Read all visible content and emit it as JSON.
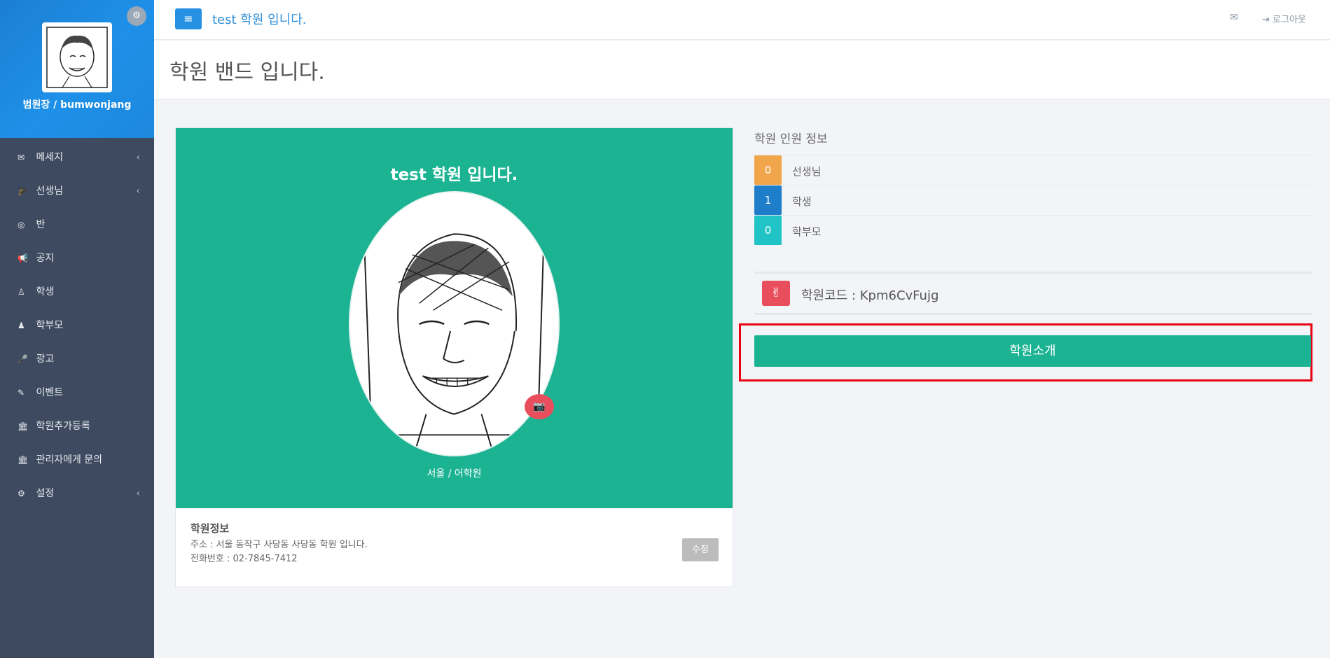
{
  "sidebar": {
    "user_name": "범원장 / bumwonjang",
    "settings_icon": "gear-icon",
    "items": [
      {
        "label": "메세지",
        "icon": "envelope-icon",
        "glyph": "✉",
        "has_arrow": true
      },
      {
        "label": "선생님",
        "icon": "graduation-cap-icon",
        "glyph": "🎓",
        "has_arrow": true
      },
      {
        "label": "반",
        "icon": "bullseye-icon",
        "glyph": "◎",
        "has_arrow": false
      },
      {
        "label": "공지",
        "icon": "bullhorn-icon",
        "glyph": "📢",
        "has_arrow": false
      },
      {
        "label": "학생",
        "icon": "child-icon",
        "glyph": "♙",
        "has_arrow": false
      },
      {
        "label": "학부모",
        "icon": "male-icon",
        "glyph": "♟",
        "has_arrow": false
      },
      {
        "label": "광고",
        "icon": "microphone-icon",
        "glyph": "🎤",
        "has_arrow": false
      },
      {
        "label": "이벤트",
        "icon": "magic-wand-icon",
        "glyph": "✎",
        "has_arrow": false
      },
      {
        "label": "학원추가등록",
        "icon": "institution-icon",
        "glyph": "🏛",
        "has_arrow": false
      },
      {
        "label": "관리자에게 문의",
        "icon": "institution-icon",
        "glyph": "🏛",
        "has_arrow": false
      },
      {
        "label": "설정",
        "icon": "gear-icon",
        "glyph": "⚙",
        "has_arrow": true
      }
    ],
    "arrow_glyph": "‹"
  },
  "topbar": {
    "menu_glyph": "≡",
    "title": "test 학원 입니다.",
    "envelope_glyph": "✉",
    "logout_label": "⇥ 로그아웃"
  },
  "page": {
    "title": "학원 밴드 입니다."
  },
  "profile_card": {
    "name": "test 학원 입니다.",
    "camera_glyph": "📷",
    "location": "서울 / 어학원",
    "info_title": "학원정보",
    "address": "주소 : 서울 동작구 사당동 사당동 학원 입니다.",
    "phone": "전화번호 : 02-7845-7412",
    "edit_label": "수정"
  },
  "stats": {
    "title": "학원 인원 정보",
    "rows": [
      {
        "count": "0",
        "label": "선생님",
        "color": "#f0a54a"
      },
      {
        "count": "1",
        "label": "학생",
        "color": "#1f7ec9"
      },
      {
        "count": "0",
        "label": "학부모",
        "color": "#20c3c6"
      }
    ]
  },
  "academy_code": {
    "icon_glyph": "✌",
    "text": "학원코드 : Kpm6CvFujg"
  },
  "intro_button": {
    "label": "학원소개",
    "highlight_color": "#e60012"
  }
}
